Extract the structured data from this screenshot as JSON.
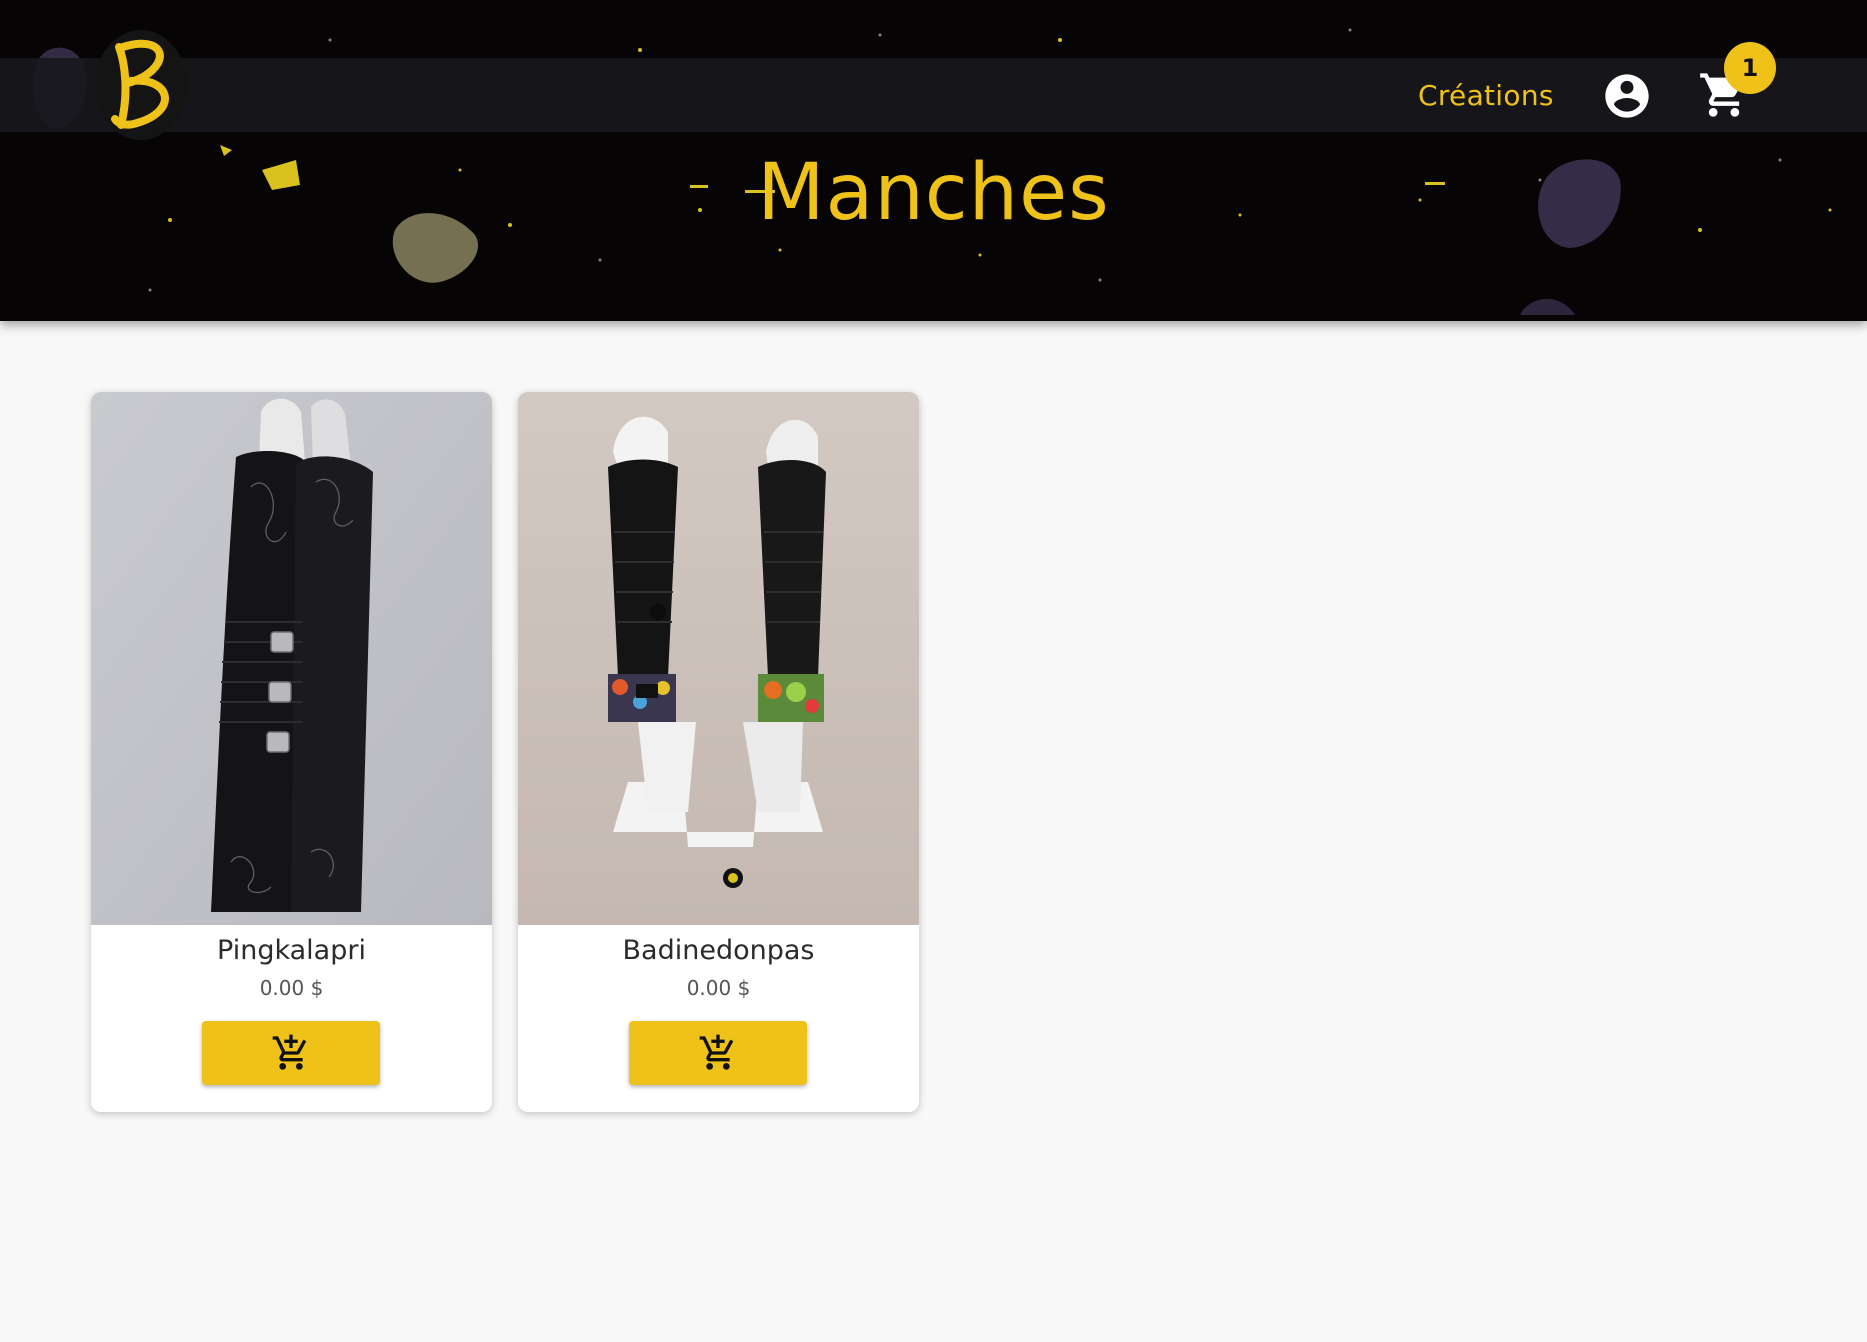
{
  "header": {
    "logo_alt": "B",
    "nav_link": "Créations",
    "account_icon": "account-circle-icon",
    "cart_icon": "shopping-cart-icon",
    "cart_count": "1"
  },
  "page": {
    "title": "Manches"
  },
  "products": [
    {
      "name": "Pingkalapri",
      "price": "0.00 $",
      "add_icon": "add-shopping-cart-icon"
    },
    {
      "name": "Badinedonpas",
      "price": "0.00 $",
      "add_icon": "add-shopping-cart-icon"
    }
  ],
  "colors": {
    "accent": "#eec218",
    "header_bg": "#050304",
    "page_bg": "#f8f8f8"
  }
}
